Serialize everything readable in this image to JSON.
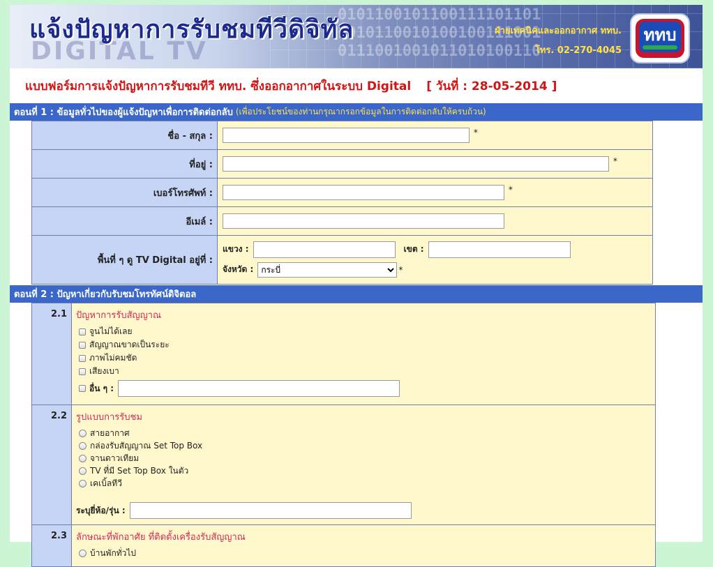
{
  "banner": {
    "title": "แจ้งปัญหาการรับชมทีวีดิจิทัล",
    "watermark": "DIGITAL TV",
    "binary": "0101100101100111101101\n1010110010100100111001\n0111001001011010100110",
    "dept": "ฝ่ายเทคนิคและออกอากาศ ททบ.",
    "phone": "โทร. 02-270-4045",
    "logo_text": "ททบ"
  },
  "heading": {
    "title": "แบบฟอร์มการแจ้งปัญหาการรับชมทีวี ททบ. ซึ่งออกอากาศในระบบ Digital",
    "date": "[ วันที่ : 28-05-2014 ]"
  },
  "section1": {
    "title": "ตอนที่ 1 : ข้อมูลทั่วไปของผู้แจ้งปัญหาเพื่อการติดต่อกลับ",
    "note": "(เพื่อประโยชน์ของท่านกรุณากรอกข้อมูลในการติดต่อกลับให้ครบถ้วน)",
    "name_label": "ชื่อ - สกุล :",
    "address_label": "ที่อยู่ :",
    "phone_label": "เบอร์โทรศัพท์ :",
    "email_label": "อีเมล์ :",
    "area_label": "พื้นที่ ๆ ดู TV Digital อยู่ที่ :",
    "district_label": "แขวง :",
    "zone_label": "เขต :",
    "province_label": "จังหวัด :",
    "province_value": "กระบี่",
    "required_mark": "*"
  },
  "section2": {
    "title": "ตอนที่ 2 : ปัญหาเกี่ยวกับรับชมโทรทัศน์ดิจิตอล",
    "q1": {
      "num": "2.1",
      "title": "ปัญหาการรับสัญญาณ",
      "options": [
        "จูนไม่ได้เลย",
        "สัญญาณขาดเป็นระยะ",
        "ภาพไม่คมชัด",
        "เสียงเบา"
      ],
      "other_label": "อื่น ๆ :"
    },
    "q2": {
      "num": "2.2",
      "title": "รูปแบบการรับชม",
      "options": [
        "สายอากาศ",
        "กล่องรับสัญญาณ Set Top Box",
        "จานดาวเทียม",
        "TV ที่มี Set Top Box ในตัว",
        "เคเบิ้ลทีวี"
      ],
      "brand_label": "ระบุยี่ห้อ/รุ่น :"
    },
    "q3": {
      "num": "2.3",
      "title": "ลักษณะที่พักอาศัย ที่ติดตั้งเครื่องรับสัญญาณ",
      "options": [
        "บ้านพักทั่วไป"
      ]
    }
  }
}
